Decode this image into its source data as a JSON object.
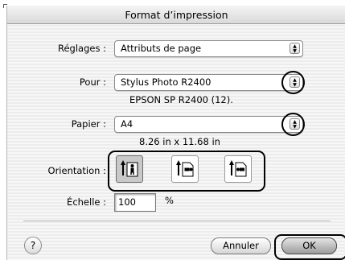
{
  "window": {
    "title": "Format d’impression"
  },
  "settings": {
    "label": "Réglages :",
    "value": "Attributs de page"
  },
  "format_for": {
    "label": "Pour :",
    "value": "Stylus Photo R2400",
    "info": "EPSON SP R2400 (12)."
  },
  "paper": {
    "label": "Papier :",
    "value": "A4",
    "info": "8.26 in x 11.68 in"
  },
  "orientation": {
    "label": "Orientation :",
    "options": [
      "portrait",
      "landscape-left",
      "landscape-right"
    ],
    "selected": "portrait"
  },
  "scale": {
    "label": "Échelle :",
    "value": "100",
    "unit": "%"
  },
  "buttons": {
    "help": "?",
    "cancel": "Annuler",
    "ok": "OK"
  },
  "icons": {
    "popup_arrows": "up-down-arrows-icon",
    "help": "question-mark-icon",
    "portrait": "portrait-orientation-icon",
    "landscape_left": "landscape-left-orientation-icon",
    "landscape_right": "landscape-right-orientation-icon"
  },
  "colors": {
    "highlight_ring": "#000000",
    "selected_orientation": "#c9c9c9"
  }
}
